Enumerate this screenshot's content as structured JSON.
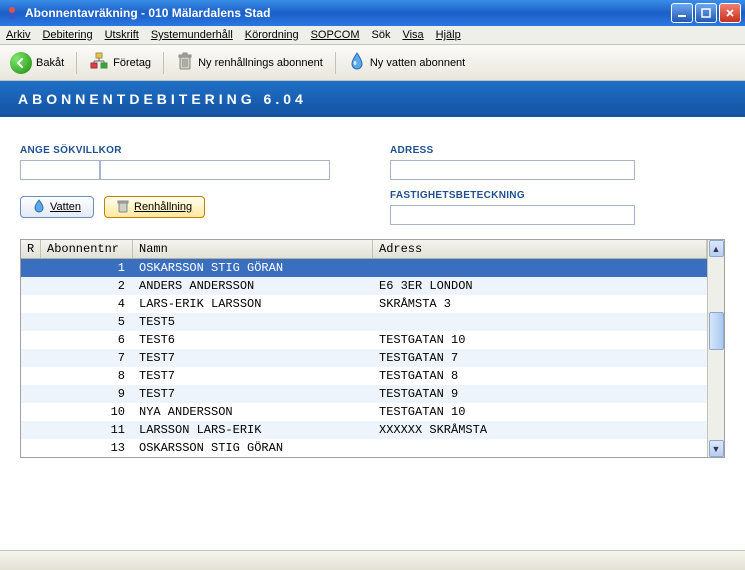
{
  "window": {
    "title": "Abonnentavräkning  -  010 Mälardalens Stad"
  },
  "menu": {
    "arkiv": "Arkiv",
    "debitering": "Debitering",
    "utskrift": "Utskrift",
    "systemunderhall": "Systemunderhåll",
    "korordning": "Körordning",
    "sopcom": "SOPCOM",
    "sok": "Sök",
    "visa": "Visa",
    "hjalp": "Hjälp"
  },
  "toolbar": {
    "back": "Bakåt",
    "company": "Företag",
    "new_waste": "Ny renhållnings abonnent",
    "new_water": "Ny vatten abonnent"
  },
  "banner": {
    "text": "ABONNENTDEBITERING  6.04"
  },
  "form": {
    "search_label": "ANGE SÖKVILLKOR",
    "address_label": "ADRESS",
    "property_label": "FASTIGHETSBETECKNING",
    "search_small_value": "",
    "search_mid_value": "",
    "address_value": "",
    "property_value": ""
  },
  "buttons": {
    "water": "Vatten",
    "waste": "Renhållning"
  },
  "grid": {
    "headers": {
      "r": "R",
      "num": "Abonnentnr",
      "name": "Namn",
      "addr": "Adress"
    },
    "rows": [
      {
        "num": "1",
        "name": "OSKARSSON STIG  GÖRAN",
        "addr": "",
        "selected": true
      },
      {
        "num": "2",
        "name": "ANDERS ANDERSSON",
        "addr": "E6 3ER LONDON"
      },
      {
        "num": "4",
        "name": "LARS-ERIK LARSSON",
        "addr": "SKRÅMSTA 3"
      },
      {
        "num": "5",
        "name": "TEST5",
        "addr": ""
      },
      {
        "num": "6",
        "name": "TEST6",
        "addr": "TESTGATAN 10"
      },
      {
        "num": "7",
        "name": "TEST7",
        "addr": "TESTGATAN 7"
      },
      {
        "num": "8",
        "name": "TEST7",
        "addr": "TESTGATAN 8"
      },
      {
        "num": "9",
        "name": "TEST7",
        "addr": "TESTGATAN 9"
      },
      {
        "num": "10",
        "name": "NYA ANDERSSON",
        "addr": "TESTGATAN 10"
      },
      {
        "num": "11",
        "name": "LARSSON LARS-ERIK",
        "addr": "XXXXXX SKRÅMSTA"
      },
      {
        "num": "13",
        "name": "OSKARSSON STIG GÖRAN",
        "addr": ""
      }
    ]
  }
}
